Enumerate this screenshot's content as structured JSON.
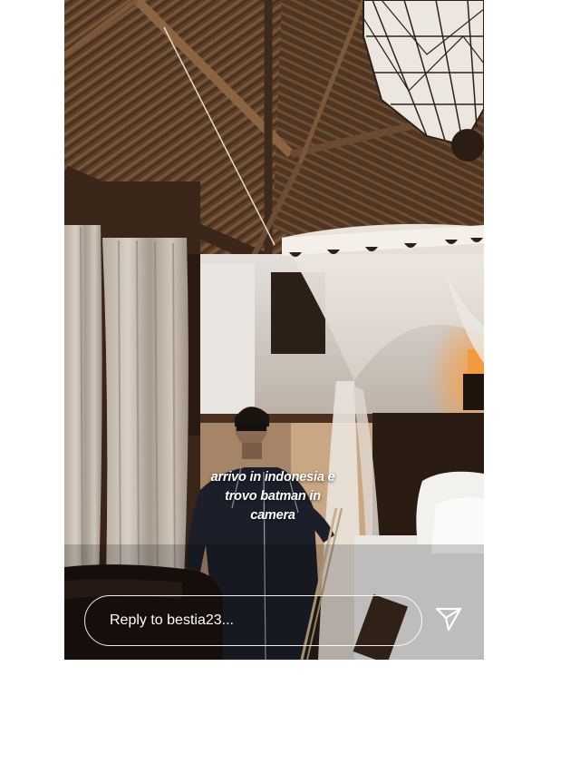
{
  "story": {
    "caption": "arrivo in indonesia e\ntrovo batman in\ncamera",
    "reply_placeholder": "Reply to bestia23...",
    "send_icon": "send-icon"
  }
}
